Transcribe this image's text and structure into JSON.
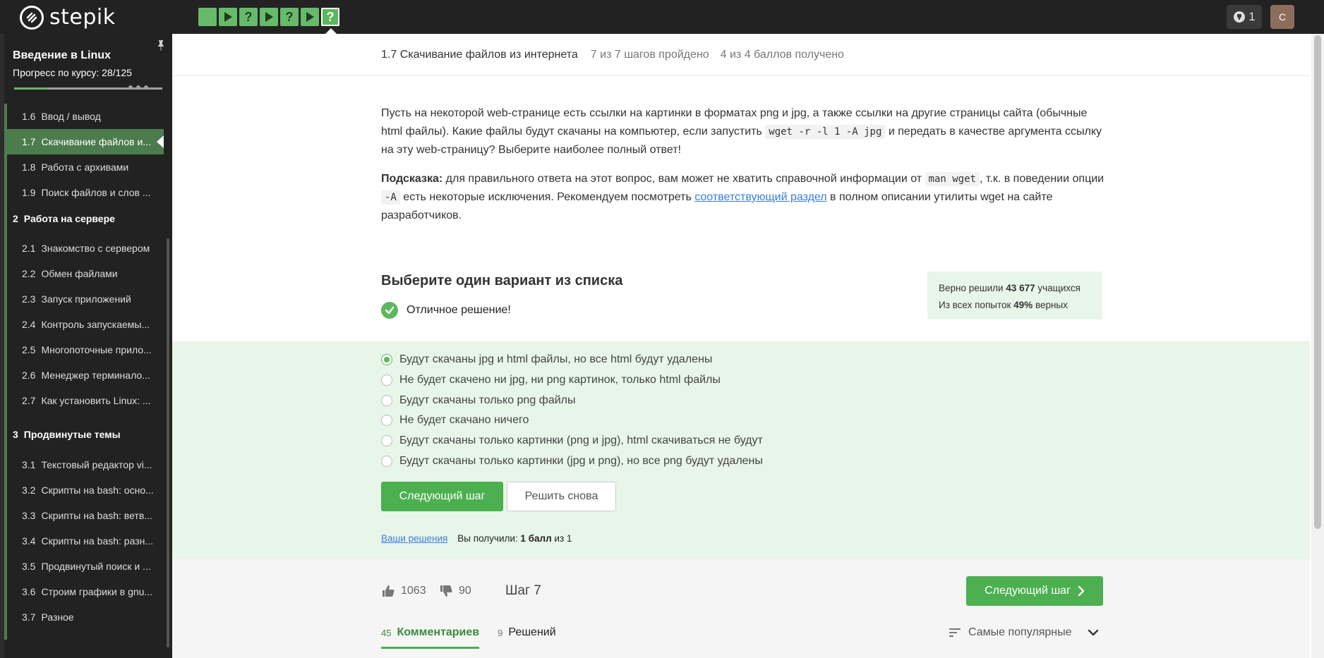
{
  "header": {
    "logo_text": "stepik",
    "steps": [
      {
        "kind": "text",
        "icon": "text-step-icon"
      },
      {
        "kind": "video",
        "icon": "play-icon"
      },
      {
        "kind": "quiz",
        "icon": "question-icon"
      },
      {
        "kind": "video",
        "icon": "play-icon"
      },
      {
        "kind": "quiz",
        "icon": "question-icon"
      },
      {
        "kind": "video",
        "icon": "play-icon"
      },
      {
        "kind": "quiz",
        "icon": "question-icon",
        "active": true
      }
    ],
    "trophy_count": "1",
    "avatar_letter": "C"
  },
  "sidebar": {
    "course_title": "Введение в Linux",
    "progress_label": "Прогресс по курсу:  28/125",
    "progress_fraction": 0.224,
    "lessons_top": [
      {
        "num": "1.6",
        "label": "Ввод / вывод"
      },
      {
        "num": "1.7",
        "label": "Скачивание файлов и...",
        "active": true
      },
      {
        "num": "1.8",
        "label": "Работа с архивами"
      },
      {
        "num": "1.9",
        "label": "Поиск файлов и слов ..."
      }
    ],
    "section2": {
      "num": "2",
      "label": "Работа на сервере"
    },
    "lessons_s2": [
      {
        "num": "2.1",
        "label": "Знакомство с сервером"
      },
      {
        "num": "2.2",
        "label": "Обмен файлами"
      },
      {
        "num": "2.3",
        "label": "Запуск приложений"
      },
      {
        "num": "2.4",
        "label": "Контроль запускаемы..."
      },
      {
        "num": "2.5",
        "label": "Многопоточные прило..."
      },
      {
        "num": "2.6",
        "label": "Менеджер терминало..."
      },
      {
        "num": "2.7",
        "label": "Как установить Linux: ..."
      }
    ],
    "section3": {
      "num": "3",
      "label": "Продвинутые темы"
    },
    "lessons_s3": [
      {
        "num": "3.1",
        "label": "Текстовый редактор vi..."
      },
      {
        "num": "3.2",
        "label": "Скрипты на bash: осно..."
      },
      {
        "num": "3.3",
        "label": "Скрипты на bash: ветв..."
      },
      {
        "num": "3.4",
        "label": "Скрипты на bash: разн..."
      },
      {
        "num": "3.5",
        "label": "Продвинутый поиск и ..."
      },
      {
        "num": "3.6",
        "label": "Строим графики в gnu..."
      },
      {
        "num": "3.7",
        "label": "Разное"
      }
    ]
  },
  "lesson_header": {
    "title": "1.7 Скачивание файлов из интернета",
    "steps_done": "7 из 7 шагов пройдено",
    "score": "4 из 4 баллов  получено"
  },
  "task": {
    "p1_a": "Пусть на некоторой web-странице есть ссылки на картинки в форматах png и jpg, а также ссылки на другие страницы сайта (обычные html файлы). Какие файлы будут скачаны на компьютер, если запустить ",
    "p1_code": "wget -r -l 1 -A jpg",
    "p1_b": " и передать в качестве аргумента ссылку на эту web-страницу? Выберите наиболее полный ответ!",
    "hint_label": "Подсказка:",
    "p2_a": " для правильного ответа на этот вопрос, вам может не хватить справочной информации от ",
    "p2_code1": "man wget",
    "p2_b": ", т.к. в поведении опции ",
    "p2_code2": "-A",
    "p2_c": " есть некоторые исключения. Рекомендуем посмотреть ",
    "p2_link": "соответствующий раздел",
    "p2_d": " в полном описании утилиты wget на сайте разработчиков."
  },
  "quiz": {
    "title": "Выберите один вариант из списка",
    "success_text": "Отличное решение!",
    "stats_line1_a": "Верно решили ",
    "stats_line1_num": "43 677",
    "stats_line1_b": " учащихся",
    "stats_line2_a": "Из всех попыток ",
    "stats_line2_num": "49%",
    "stats_line2_b": " верных",
    "options": [
      {
        "label": "Будут скачаны jpg и html файлы, но все html будут удалены",
        "selected": true
      },
      {
        "label": "Не будет скачено ни jpg, ни png картинок, только html файлы"
      },
      {
        "label": "Будут скачаны только png файлы"
      },
      {
        "label": "Не будет скачано ничего"
      },
      {
        "label": "Будут скачаны только картинки (png и jpg), html скачиваться не будут"
      },
      {
        "label": "Будут скачаны только картинки (jpg и png), но все png будут удалены"
      }
    ],
    "next_button": "Следующий шаг",
    "retry_button": "Решить снова",
    "your_solutions": "Ваши решения",
    "received_a": "Вы получили: ",
    "received_bold": "1 балл",
    "received_b": " из 1"
  },
  "footer": {
    "likes": "1063",
    "dislikes": "90",
    "step_label": "Шаг 7",
    "next_button": "Следующий шаг",
    "tab_comments_count": "45",
    "tab_comments": "Комментариев",
    "tab_solutions_count": "9",
    "tab_solutions": "Решений",
    "sort_label": "Самые популярные"
  },
  "colors": {
    "accent": "#4caf50",
    "dark": "#222222",
    "success_bg": "#e8f5e9",
    "link": "#3b7ddd"
  }
}
